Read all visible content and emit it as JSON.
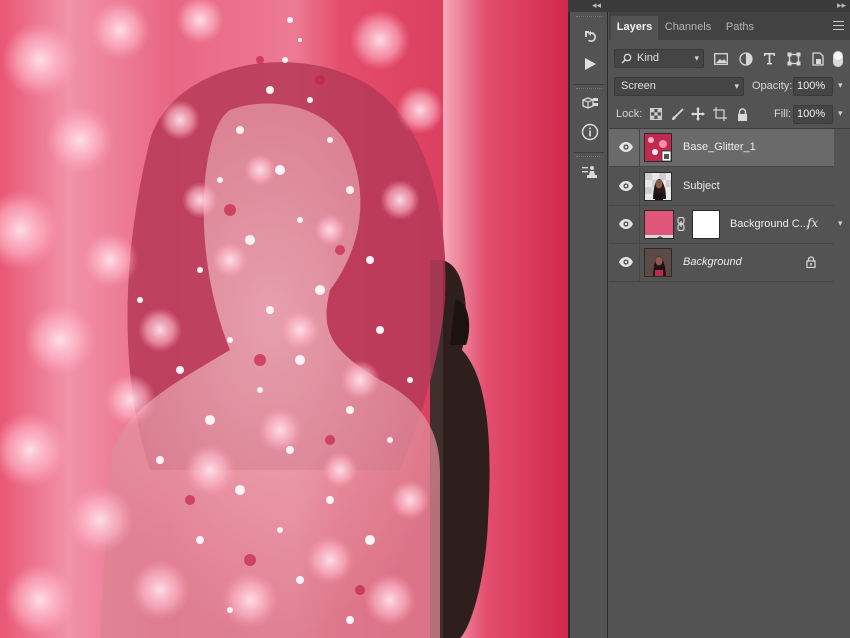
{
  "topbar": {
    "collapse_left": "◂◂",
    "collapse_right": "▸▸"
  },
  "tool_strip": {
    "tools": [
      {
        "icon": "history-brush-icon"
      },
      {
        "icon": "play-action-icon"
      },
      {
        "icon": "3d-cube-icon"
      },
      {
        "icon": "info-icon"
      },
      {
        "icon": "clone-source-icon"
      }
    ]
  },
  "panel": {
    "tabs": [
      {
        "label": "Layers",
        "active": true
      },
      {
        "label": "Channels",
        "active": false
      },
      {
        "label": "Paths",
        "active": false
      }
    ],
    "filter": {
      "kind_label": "Kind",
      "icons": [
        "image-filter-icon",
        "adjustment-filter-icon",
        "type-filter-icon",
        "shape-filter-icon",
        "smart-object-filter-icon"
      ]
    },
    "blend": {
      "mode": "Screen",
      "opacity_label": "Opacity:",
      "opacity_value": "100%"
    },
    "lock": {
      "label": "Lock:",
      "fill_label": "Fill:",
      "fill_value": "100%",
      "icons": [
        "lock-transparent-pixels-icon",
        "lock-image-pixels-icon",
        "lock-position-icon",
        "lock-artboard-icon",
        "lock-all-icon"
      ]
    },
    "layers": [
      {
        "name": "Base_Glitter_1",
        "selected": true,
        "italic": false,
        "visible": true,
        "thumb": "glitter"
      },
      {
        "name": "Subject",
        "selected": false,
        "italic": false,
        "visible": true,
        "thumb": "subject"
      },
      {
        "name": "Background C...",
        "selected": false,
        "italic": false,
        "visible": true,
        "thumb": "color-fill",
        "fx": "fx",
        "has_mask": true
      },
      {
        "name": "Background",
        "selected": false,
        "italic": true,
        "visible": true,
        "thumb": "background",
        "locked": true
      }
    ]
  },
  "colors": {
    "canvas_pink": "#e85a79",
    "canvas_red": "#d42a4d",
    "fill_swatch": "#e0567a",
    "panel_bg": "#535353",
    "selected_row": "#6a6a6a"
  }
}
